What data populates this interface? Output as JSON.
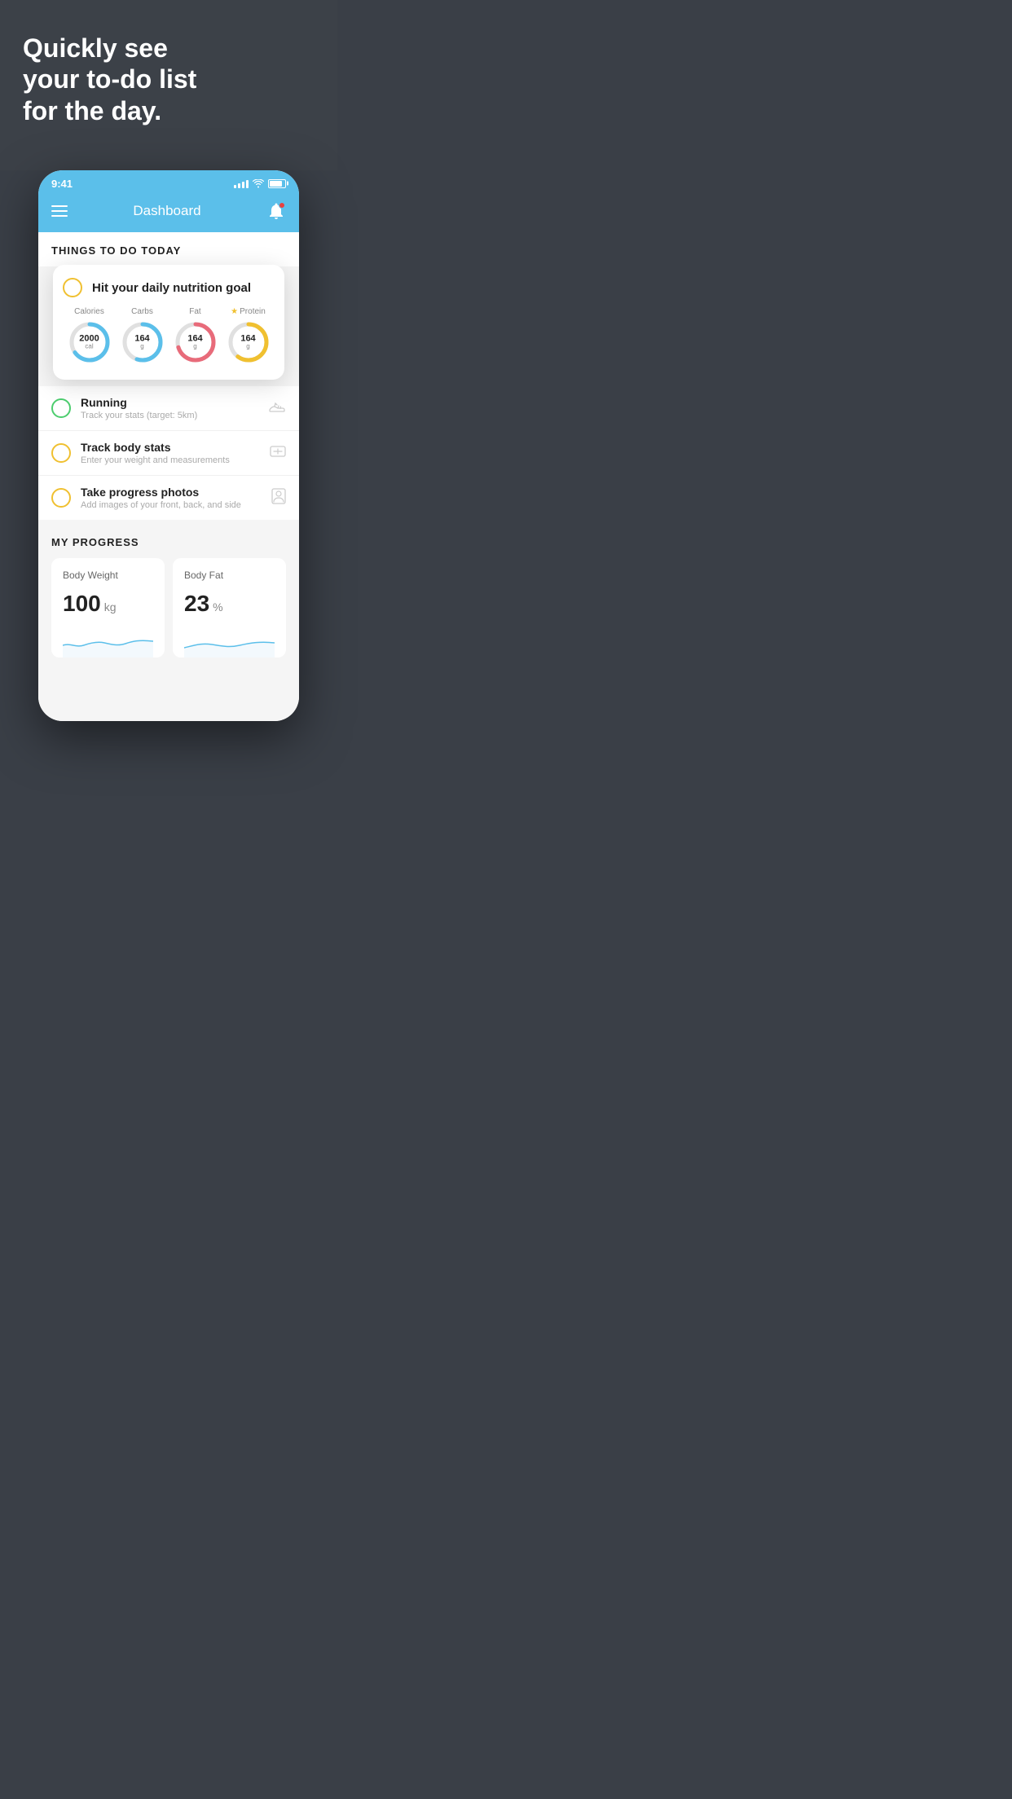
{
  "headline": {
    "line1": "Quickly see",
    "line2": "your to-do list",
    "line3": "for the day."
  },
  "phone": {
    "status_bar": {
      "time": "9:41",
      "signal_bars": [
        4,
        6,
        8,
        10,
        12
      ],
      "wifi": "wifi",
      "battery": "battery"
    },
    "header": {
      "title": "Dashboard",
      "menu_label": "menu",
      "bell_label": "notifications"
    },
    "things_to_do": {
      "section_title": "THINGS TO DO TODAY"
    },
    "nutrition_card": {
      "task_label": "Hit your daily nutrition goal",
      "macros": [
        {
          "label": "Calories",
          "value": "2000",
          "unit": "cal",
          "color_track": "#e0e0e0",
          "color_fill": "#5bbfea",
          "percent": 65,
          "starred": false
        },
        {
          "label": "Carbs",
          "value": "164",
          "unit": "g",
          "color_track": "#e0e0e0",
          "color_fill": "#5bbfea",
          "percent": 55,
          "starred": false
        },
        {
          "label": "Fat",
          "value": "164",
          "unit": "g",
          "color_track": "#e0e0e0",
          "color_fill": "#e86b7a",
          "percent": 70,
          "starred": false
        },
        {
          "label": "Protein",
          "value": "164",
          "unit": "g",
          "color_track": "#e0e0e0",
          "color_fill": "#f0c030",
          "percent": 60,
          "starred": true
        }
      ]
    },
    "todo_items": [
      {
        "title": "Running",
        "subtitle": "Track your stats (target: 5km)",
        "icon": "shoe",
        "circle_color": "green",
        "completed": true
      },
      {
        "title": "Track body stats",
        "subtitle": "Enter your weight and measurements",
        "icon": "scale",
        "circle_color": "yellow",
        "completed": false
      },
      {
        "title": "Take progress photos",
        "subtitle": "Add images of your front, back, and side",
        "icon": "camera",
        "circle_color": "yellow",
        "completed": false
      }
    ],
    "progress": {
      "section_title": "MY PROGRESS",
      "cards": [
        {
          "title": "Body Weight",
          "value": "100",
          "unit": "kg"
        },
        {
          "title": "Body Fat",
          "value": "23",
          "unit": "%"
        }
      ]
    }
  }
}
